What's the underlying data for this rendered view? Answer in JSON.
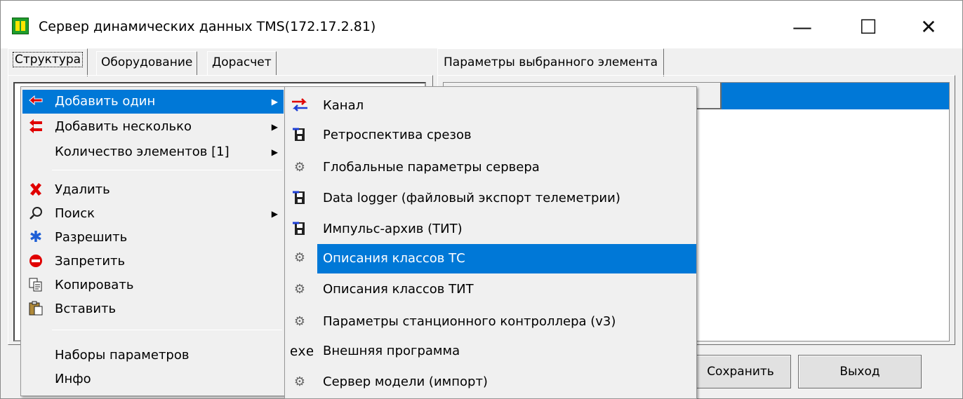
{
  "window": {
    "title": "Сервер динамических данных TMS(172.17.2.81)",
    "controls": {
      "minimize": "—",
      "maximize": "☐",
      "close": "✕"
    }
  },
  "left_tabs": [
    {
      "label": "Структура",
      "active": true
    },
    {
      "label": "Оборудование",
      "active": false
    },
    {
      "label": "Дорасчет",
      "active": false
    }
  ],
  "right_tab": {
    "label": "Параметры выбранного элемента"
  },
  "buttons": {
    "save": "Сохранить",
    "exit": "Выход"
  },
  "context_menu": {
    "items": [
      {
        "label": "Добавить один",
        "icon": "arrow-left-red-icon",
        "submenu": true,
        "selected": true
      },
      {
        "label": "Добавить несколько",
        "icon": "double-arrow-red-icon",
        "submenu": true,
        "selected": false
      },
      {
        "label": "Количество элементов [1]",
        "icon": "",
        "submenu": true,
        "selected": false
      },
      {
        "label": "Удалить",
        "icon": "red-x-icon",
        "submenu": false
      },
      {
        "label": "Поиск",
        "icon": "search-icon",
        "submenu": true
      },
      {
        "label": "Разрешить",
        "icon": "blue-star-icon",
        "submenu": false
      },
      {
        "label": "Запретить",
        "icon": "stop-icon",
        "submenu": false
      },
      {
        "label": "Копировать",
        "icon": "copy-icon",
        "submenu": false
      },
      {
        "label": "Вставить",
        "icon": "paste-icon",
        "submenu": false
      },
      {
        "label": "Наборы параметров",
        "icon": "",
        "submenu": false
      },
      {
        "label": "Инфо",
        "icon": "",
        "submenu": false
      }
    ]
  },
  "submenu": {
    "items": [
      {
        "label": "Канал",
        "icon": "channel-arrows-icon",
        "selected": false
      },
      {
        "label": "Ретроспектива срезов",
        "icon": "save-disk-icon",
        "selected": false
      },
      {
        "label": "Глобальные параметры сервера",
        "icon": "gears-icon",
        "selected": false
      },
      {
        "label": "Data logger (файловый экспорт телеметрии)",
        "icon": "save-disk-icon",
        "selected": false
      },
      {
        "label": "Импульс-архив (ТИТ)",
        "icon": "save-disk-icon",
        "selected": false
      },
      {
        "label": "Описания классов ТС",
        "icon": "gears-icon",
        "selected": true
      },
      {
        "label": "Описания классов ТИТ",
        "icon": "gears-icon",
        "selected": false
      },
      {
        "label": "Параметры станционного контроллера (v3)",
        "icon": "gears-icon",
        "selected": false
      },
      {
        "label": "Внешняя программа",
        "icon": "exe-icon",
        "icon_text": "exe",
        "selected": false
      },
      {
        "label": "Сервер модели (импорт)",
        "icon": "gears-icon",
        "selected": false
      }
    ]
  },
  "colors": {
    "selection": "#0078d7",
    "window_bg": "#f0f0f0"
  }
}
